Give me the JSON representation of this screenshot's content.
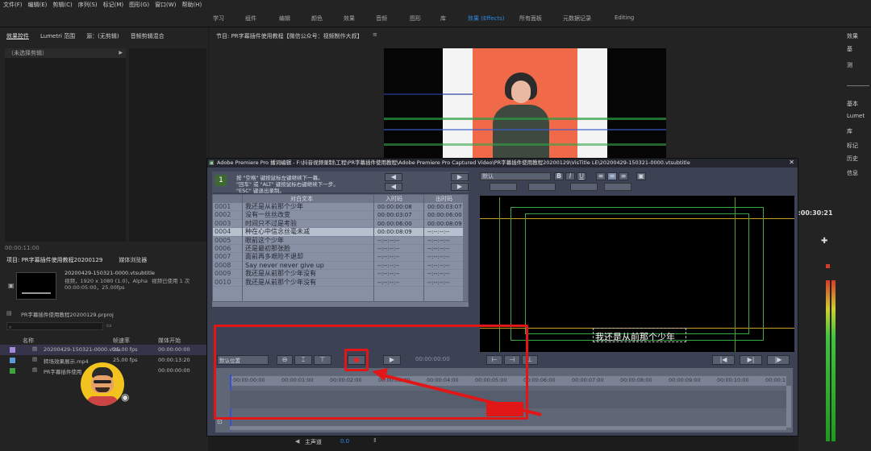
{
  "menu": [
    "文件(F)",
    "编辑(E)",
    "剪辑(C)",
    "序列(S)",
    "标记(M)",
    "图形(G)",
    "窗口(W)",
    "帮助(H)"
  ],
  "workspaces": [
    "学习",
    "组件",
    "编辑",
    "颜色",
    "效果",
    "音频",
    "图形",
    "库",
    "效果 (Effects)",
    "所有面板",
    "元数据记录",
    "Editing"
  ],
  "workspace_active": "效果 (Effects)",
  "left_panel": {
    "tabs": [
      "效果控件",
      "Lumetri 范围",
      "源：(无剪辑)",
      "音频剪辑混合"
    ],
    "no_clip": "（未选择剪辑）",
    "timecode": "00:00:11:00"
  },
  "program": {
    "title": "节目: PR字幕插件使用教程【微信公众号：视频制作大叔】"
  },
  "project": {
    "tabs": [
      "项目: PR字幕插件使用教程20200129",
      "媒体浏览器"
    ],
    "clip_name": "20200429-150321-0000.vtsubtitle",
    "clip_info": "视频，1920 x 1080 (1.0)，Alpha",
    "clip_used": "视频已使用 1 次",
    "clip_dur": "00:00:05:00，25.00fps",
    "file": "PR字幕插件使用教程20200129.prproj",
    "columns": [
      "名称",
      "帧速率",
      "媒体开始"
    ],
    "rows": [
      {
        "name": "20200429-150321-0000.vtsu",
        "fps": "25.00 fps",
        "start": "00:00:00:00",
        "color": "#a58bd8"
      },
      {
        "name": "转场效果展示.mp4",
        "fps": "25.00 fps",
        "start": "00:00:13:20",
        "color": "#5b9bd8"
      },
      {
        "name": "PR字幕插件使用",
        "fps": "",
        "start": "00:00:00:00",
        "color": "#3ea53e"
      }
    ]
  },
  "right_panel": {
    "items": [
      "效果",
      "基",
      "测",
      "基本",
      "Lumet",
      "库",
      "标记",
      "历史",
      "信息"
    ]
  },
  "timeline_bottom": {
    "track": "主声道",
    "value": "0.0"
  },
  "right_timecode": "0:00:30:21",
  "dialog": {
    "title": "Adobe Premiere Pro 播词编辑 - F:\\抖音视频录制\\工程\\PR字幕插件使用教程\\Adobe Premiere Pro Captured Video\\PR字幕插件使用教程20200129\\VisTitle LE\\20200429-150321-0000.vtsubtitle",
    "hint1": "按 \"空格\" 键按鼠标左键继续下一幕。",
    "hint2": "\"回车\" 或 \"ALT\" 键按鼠标右键继续下一步。",
    "hint3": "\"ESC\" 键退出录制。",
    "preset": "默认",
    "columns": [
      "",
      "对白文本",
      "入时码",
      "出时码"
    ],
    "rows": [
      {
        "id": "0001",
        "text": "我还是从前那个少年",
        "in": "00:00:00:08",
        "out": "00:00:03:07"
      },
      {
        "id": "0002",
        "text": "没有一丝丝改变",
        "in": "00:00:03:07",
        "out": "00:00:06:00"
      },
      {
        "id": "0003",
        "text": "时间只不过是考验",
        "in": "00:00:06:00",
        "out": "00:00:08:09"
      },
      {
        "id": "0004",
        "text": "种在心中信念丝毫未减",
        "in": "00:00:08:09",
        "out": "--:--:--:--"
      },
      {
        "id": "0005",
        "text": "眼前这个少年",
        "in": "--:--:--:--",
        "out": "--:--:--:--"
      },
      {
        "id": "0006",
        "text": "还是最初那张脸",
        "in": "--:--:--:--",
        "out": "--:--:--:--"
      },
      {
        "id": "0007",
        "text": "面前再多艰险不退却",
        "in": "--:--:--:--",
        "out": "--:--:--:--"
      },
      {
        "id": "0008",
        "text": "Say never never give up",
        "in": "--:--:--:--",
        "out": "--:--:--:--"
      },
      {
        "id": "0009",
        "text": "我还是从前那个少年没有",
        "in": "--:--:--:--",
        "out": "--:--:--:--"
      },
      {
        "id": "0010",
        "text": "我还是从前那个少年没有",
        "in": "--:--:--:--",
        "out": "--:--:--:--"
      }
    ],
    "selected_row": "0004",
    "subtitle_preview": "我还是从前那个少年",
    "rec_timecode": "00:00:00:00",
    "ruler": [
      "00:00:00:00",
      "00:00:01:00",
      "00:00:02:00",
      "00:00:03:00",
      "00:00:04:00",
      "00:00:05:00",
      "00:00:06:00",
      "00:00:07:00",
      "00:00:08:00",
      "00:00:09:00",
      "00:00:10:00",
      "00:00:1"
    ],
    "dropdown": "默认位置"
  },
  "accent": "#2d8ceb",
  "annotation_color": "#e11717"
}
